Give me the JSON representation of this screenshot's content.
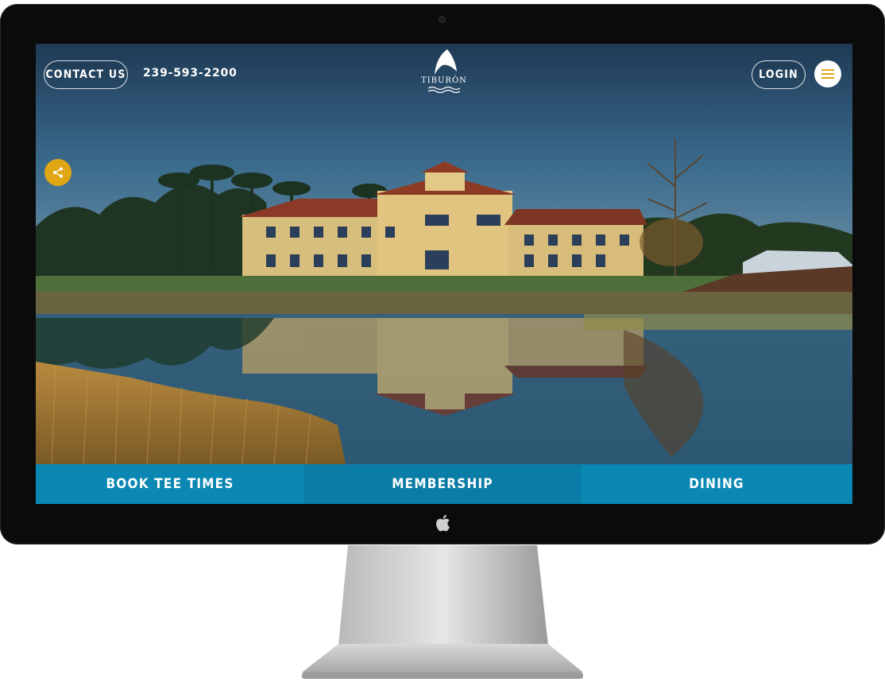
{
  "header": {
    "contact_label": "CONTACT US",
    "phone": "239-593-2200",
    "login_label": "LOGIN",
    "logo_text": "TIBURÓN"
  },
  "bottom_nav": {
    "items": [
      {
        "label": "BOOK TEE TIMES"
      },
      {
        "label": "MEMBERSHIP"
      },
      {
        "label": "DINING"
      }
    ]
  },
  "icons": {
    "menu": "hamburger-icon",
    "share": "share-icon",
    "logo": "shark-fin-logo",
    "device": "apple-logo"
  },
  "colors": {
    "nav_blue": "#0b87b3",
    "share_gold": "#e0a614",
    "menu_gold": "#e0a614"
  }
}
